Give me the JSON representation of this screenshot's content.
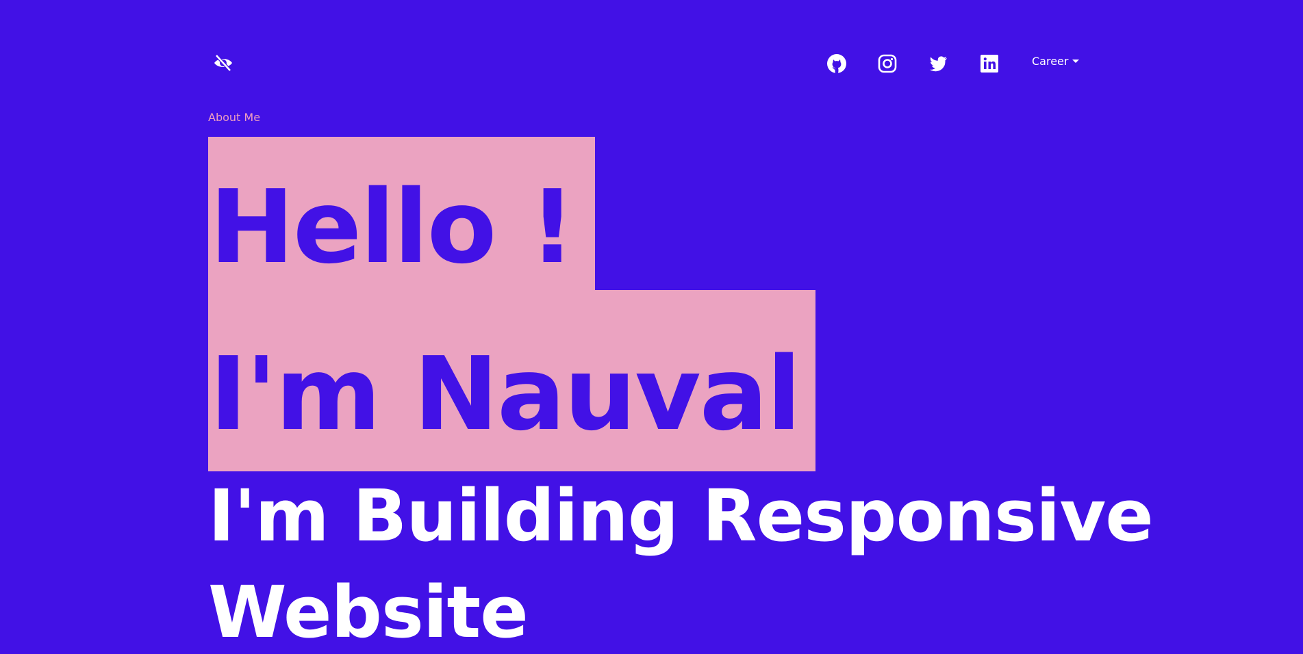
{
  "nav": {
    "brand_icon": "eye-slash-icon",
    "social": [
      {
        "name": "github",
        "icon": "github-icon"
      },
      {
        "name": "instagram",
        "icon": "instagram-icon"
      },
      {
        "name": "twitter",
        "icon": "twitter-icon"
      },
      {
        "name": "linkedin",
        "icon": "linkedin-icon"
      }
    ],
    "career_label": "Career"
  },
  "hero": {
    "section_label": "About Me",
    "greeting_line1": "Hello !",
    "greeting_line2": "I'm Nauval",
    "tagline_line1": "I'm Building Responsive",
    "tagline_line2": "Website"
  },
  "colors": {
    "background": "#4211e6",
    "highlight": "#eba3c1",
    "accent_text": "#ee9fc0",
    "text": "#ffffff"
  }
}
